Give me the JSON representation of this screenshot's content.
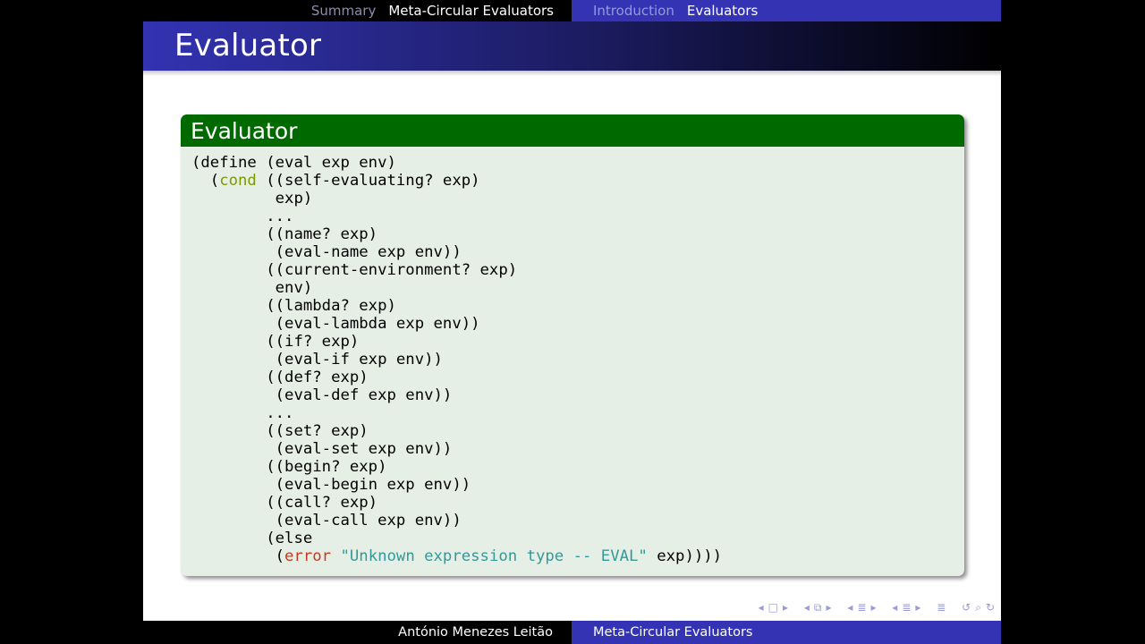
{
  "header": {
    "left_section": "Summary",
    "left_current": "Meta-Circular Evaluators",
    "right_section": "Introduction",
    "right_current": "Evaluators"
  },
  "slide": {
    "title": "Evaluator"
  },
  "block": {
    "title": "Evaluator",
    "code_lines": [
      [
        {
          "t": "(define (eval exp env)"
        }
      ],
      [
        {
          "t": "  ("
        },
        {
          "t": "cond",
          "c": "kw-cond"
        },
        {
          "t": " ((self-evaluating? exp)"
        }
      ],
      [
        {
          "t": "         exp)"
        }
      ],
      [
        {
          "t": "        ..."
        }
      ],
      [
        {
          "t": "        ((name? exp)"
        }
      ],
      [
        {
          "t": "         (eval-name exp env))"
        }
      ],
      [
        {
          "t": "        ((current-environment? exp)"
        }
      ],
      [
        {
          "t": "         env)"
        }
      ],
      [
        {
          "t": "        ((lambda? exp)"
        }
      ],
      [
        {
          "t": "         (eval-lambda exp env))"
        }
      ],
      [
        {
          "t": "        ((if? exp)"
        }
      ],
      [
        {
          "t": "         (eval-if exp env))"
        }
      ],
      [
        {
          "t": "        ((def? exp)"
        }
      ],
      [
        {
          "t": "         (eval-def exp env))"
        }
      ],
      [
        {
          "t": "        ..."
        }
      ],
      [
        {
          "t": "        ((set? exp)"
        }
      ],
      [
        {
          "t": "         (eval-set exp env))"
        }
      ],
      [
        {
          "t": "        ((begin? exp)"
        }
      ],
      [
        {
          "t": "         (eval-begin exp env))"
        }
      ],
      [
        {
          "t": "        ((call? exp)"
        }
      ],
      [
        {
          "t": "         (eval-call exp env))"
        }
      ],
      [
        {
          "t": "        (else"
        }
      ],
      [
        {
          "t": "         ("
        },
        {
          "t": "error",
          "c": "kw-error"
        },
        {
          "t": " "
        },
        {
          "t": "\"Unknown expression type -- EVAL\"",
          "c": "str"
        },
        {
          "t": " exp))))"
        }
      ]
    ]
  },
  "footer": {
    "author": "António Menezes Leitão",
    "talk_title": "Meta-Circular Evaluators"
  },
  "nav_icons": [
    "frame-prev-icon",
    "frame-icon",
    "frame-next-icon",
    "subsection-prev-icon",
    "subsection-icon",
    "subsection-next-icon",
    "section-prev-icon",
    "section-icon",
    "section-next-icon",
    "subsection-prev2-icon",
    "subsection2-icon",
    "subsection-next2-icon",
    "toc-icon",
    "undo-icon",
    "search-icon",
    "redo-icon"
  ],
  "colors": {
    "theme_blue": "#3333b3",
    "block_header": "#006a00",
    "block_body": "#e6efe6",
    "keyword_cond": "#7a9a00",
    "keyword_error": "#c8381c",
    "string": "#339999"
  }
}
